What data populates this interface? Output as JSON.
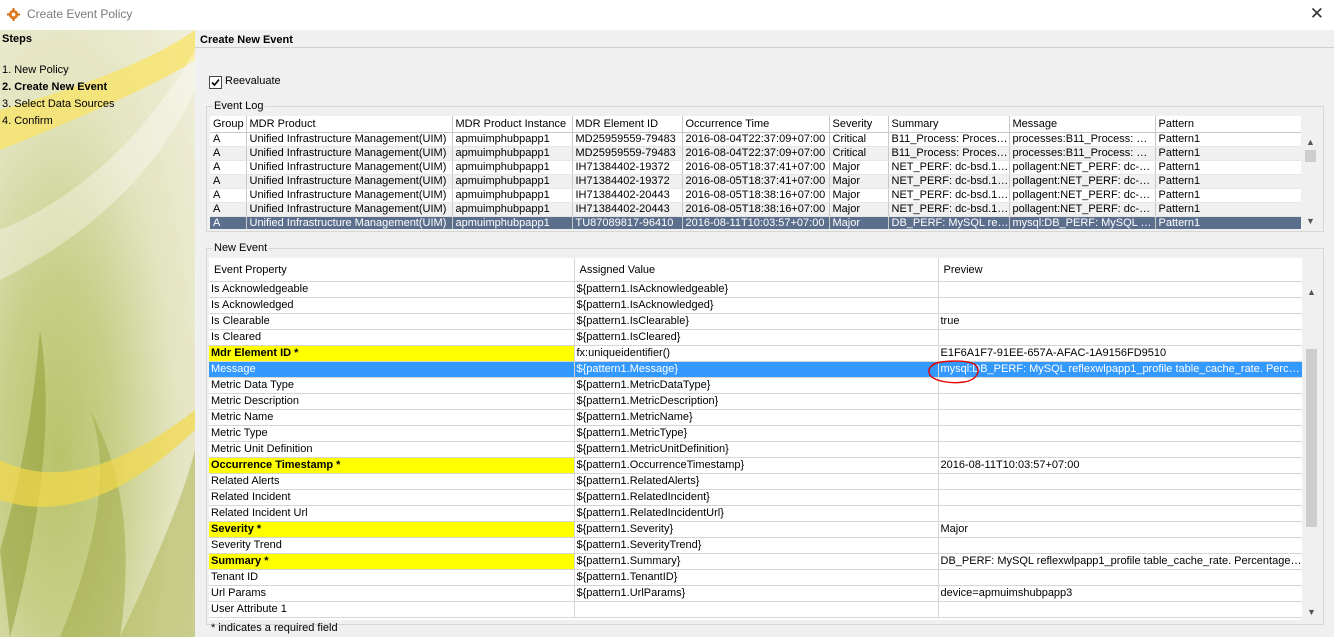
{
  "window": {
    "title": "Create Event Policy",
    "close_glyph": "✕"
  },
  "steps": {
    "header": "Steps",
    "items": [
      {
        "label": "1. New Policy",
        "current": false
      },
      {
        "label": "2. Create New Event",
        "current": true
      },
      {
        "label": "3. Select Data Sources",
        "current": false
      },
      {
        "label": "4. Confirm",
        "current": false
      }
    ]
  },
  "main": {
    "header": "Create New Event",
    "reevaluate": {
      "label": "Reevaluate",
      "checked": true
    },
    "event_log": {
      "title": "Event Log",
      "columns": [
        "Group",
        "MDR Product",
        "MDR Product Instance",
        "MDR Element ID",
        "Occurrence Time",
        "Severity",
        "Summary",
        "Message",
        "Pattern"
      ],
      "rows": [
        [
          "A",
          "Unified Infrastructure Management(UIM)",
          "apmuimphubpapp1",
          "MD25959559-79483",
          "2016-08-04T22:37:09+07:00",
          "Critical",
          "B11_Process: Process...",
          "processes:B11_Process: Pr...",
          "Pattern1"
        ],
        [
          "A",
          "Unified Infrastructure Management(UIM)",
          "apmuimphubpapp1",
          "MD25959559-79483",
          "2016-08-04T22:37:09+07:00",
          "Critical",
          "B11_Process: Process...",
          "processes:B11_Process: Pr...",
          "Pattern1"
        ],
        [
          "A",
          "Unified Infrastructure Management(UIM)",
          "apmuimphubpapp1",
          "IH71384402-19372",
          "2016-08-05T18:37:41+07:00",
          "Major",
          "NET_PERF: dc-bsd.1 ...",
          "pollagent:NET_PERF: dc-bs...",
          "Pattern1"
        ],
        [
          "A",
          "Unified Infrastructure Management(UIM)",
          "apmuimphubpapp1",
          "IH71384402-19372",
          "2016-08-05T18:37:41+07:00",
          "Major",
          "NET_PERF: dc-bsd.1 ...",
          "pollagent:NET_PERF: dc-bs...",
          "Pattern1"
        ],
        [
          "A",
          "Unified Infrastructure Management(UIM)",
          "apmuimphubpapp1",
          "IH71384402-20443",
          "2016-08-05T18:38:16+07:00",
          "Major",
          "NET_PERF: dc-bsd.1 ...",
          "pollagent:NET_PERF: dc-bs...",
          "Pattern1"
        ],
        [
          "A",
          "Unified Infrastructure Management(UIM)",
          "apmuimphubpapp1",
          "IH71384402-20443",
          "2016-08-05T18:38:16+07:00",
          "Major",
          "NET_PERF: dc-bsd.1 ...",
          "pollagent:NET_PERF: dc-bs...",
          "Pattern1"
        ],
        [
          "A",
          "Unified Infrastructure Management(UIM)",
          "apmuimphubpapp1",
          "TU87089817-96410",
          "2016-08-11T10:03:57+07:00",
          "Major",
          "DB_PERF: MySQL refl...",
          "mysql:DB_PERF: MySQL re...",
          "Pattern1"
        ]
      ],
      "selected_row": 6
    },
    "new_event": {
      "title": "New Event",
      "columns": [
        "Event Property",
        "Assigned Value",
        "Preview"
      ],
      "rows": [
        {
          "property": "Is Acknowledgeable",
          "value": "${pattern1.IsAcknowledgeable}",
          "preview": "",
          "required": false
        },
        {
          "property": "Is Acknowledged",
          "value": "${pattern1.IsAcknowledged}",
          "preview": "",
          "required": false
        },
        {
          "property": "Is Clearable",
          "value": "${pattern1.IsClearable}",
          "preview": "true",
          "required": false
        },
        {
          "property": "Is Cleared",
          "value": "${pattern1.IsCleared}",
          "preview": "",
          "required": false
        },
        {
          "property": "Mdr Element ID *",
          "value": "fx:uniqueidentifier()",
          "preview": "E1F6A1F7-91EE-657A-AFAC-1A9156FD9510",
          "required": true
        },
        {
          "property": "Message",
          "value": "${pattern1.Message}",
          "preview": "mysql:DB_PERF: MySQL reflexwlpapp1_profile table_cache_rate. Percen...",
          "required": false
        },
        {
          "property": "Metric Data Type",
          "value": "${pattern1.MetricDataType}",
          "preview": "",
          "required": false
        },
        {
          "property": "Metric Description",
          "value": "${pattern1.MetricDescription}",
          "preview": "",
          "required": false
        },
        {
          "property": "Metric Name",
          "value": "${pattern1.MetricName}",
          "preview": "",
          "required": false
        },
        {
          "property": "Metric Type",
          "value": "${pattern1.MetricType}",
          "preview": "",
          "required": false
        },
        {
          "property": "Metric Unit Definition",
          "value": "${pattern1.MetricUnitDefinition}",
          "preview": "",
          "required": false
        },
        {
          "property": "Occurrence Timestamp *",
          "value": "${pattern1.OccurrenceTimestamp}",
          "preview": "2016-08-11T10:03:57+07:00",
          "required": true
        },
        {
          "property": "Related Alerts",
          "value": "${pattern1.RelatedAlerts}",
          "preview": "",
          "required": false
        },
        {
          "property": "Related Incident",
          "value": "${pattern1.RelatedIncident}",
          "preview": "",
          "required": false
        },
        {
          "property": "Related Incident Url",
          "value": "${pattern1.RelatedIncidentUrl}",
          "preview": "",
          "required": false
        },
        {
          "property": "Severity *",
          "value": "${pattern1.Severity}",
          "preview": "Major",
          "required": true
        },
        {
          "property": "Severity Trend",
          "value": "${pattern1.SeverityTrend}",
          "preview": "",
          "required": false
        },
        {
          "property": "Summary *",
          "value": "${pattern1.Summary}",
          "preview": "DB_PERF: MySQL reflexwlpapp1_profile table_cache_rate. Percentage o...",
          "required": true
        },
        {
          "property": "Tenant ID",
          "value": "${pattern1.TenantID}",
          "preview": "",
          "required": false
        },
        {
          "property": "Url Params",
          "value": "${pattern1.UrlParams}",
          "preview": "device=apmuimshubpapp3",
          "required": false
        },
        {
          "property": "User Attribute 1",
          "value": "",
          "preview": "",
          "required": false
        }
      ],
      "selected_row": 5
    },
    "footnote": "* indicates a required field"
  },
  "colors": {
    "required_highlight": "#ffff00",
    "selection": "#3399ff",
    "log_selection": "#5b6f8d",
    "annotation": "#e00000"
  }
}
